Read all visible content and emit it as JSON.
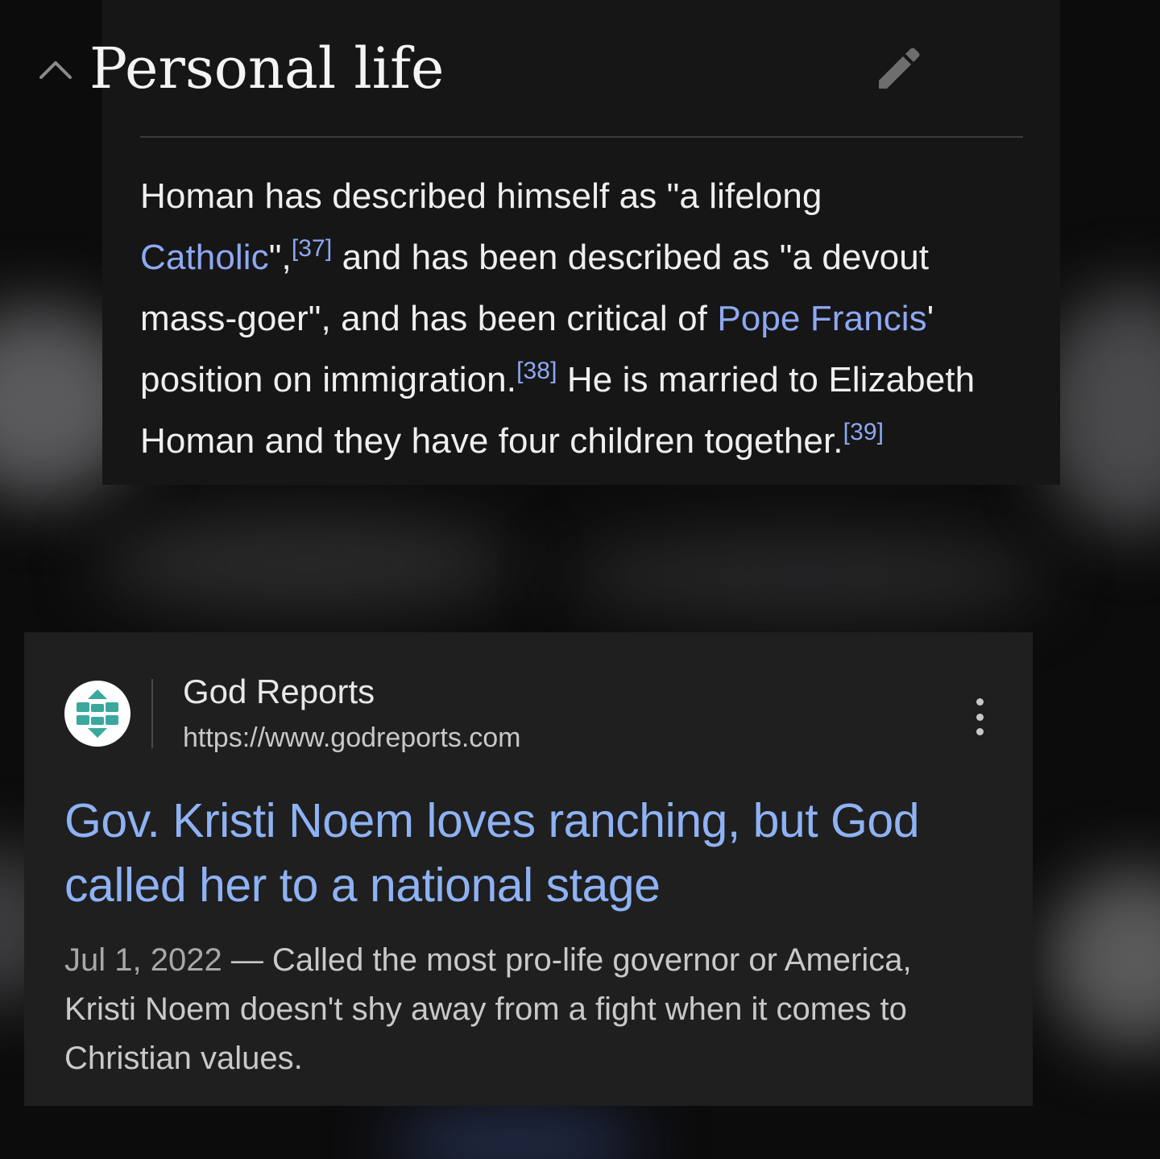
{
  "wiki": {
    "section_title": "Personal life",
    "lines": [
      {
        "text_a": "Homan has described himself as \"a lifelong"
      },
      {
        "link": "Catholic",
        "text_a": "\",",
        "cite": "[37]",
        "text_b": " and has been described as \"a devout"
      },
      {
        "text_a": "mass-goer\", and has been critical of ",
        "link": "Pope Francis",
        "text_b": "'"
      },
      {
        "text_a": "position on immigration.",
        "cite": "[38]",
        "text_b": " He is married to Elizabeth"
      },
      {
        "text_a": "Homan and they have four children together.",
        "cite": "[39]"
      }
    ]
  },
  "result": {
    "site_name": "God Reports",
    "site_url": "https://www.godreports.com",
    "title_lines": [
      "Gov. Kristi Noem loves ranching, but God",
      "called her to a national stage"
    ],
    "date": "Jul 1, 2022",
    "snippet_first": " — Called the most pro-life governor or America,",
    "snippet_lines": [
      "Kristi Noem doesn't shy away from a fight when it comes to",
      "Christian values."
    ]
  },
  "colors": {
    "link": "#8ea8f2",
    "result_title": "#8eb2f4",
    "favicon_teal": "#3aa89d"
  },
  "icons": [
    "chevron-up-icon",
    "pencil-icon",
    "favicon-icon",
    "more-vert-icon"
  ]
}
